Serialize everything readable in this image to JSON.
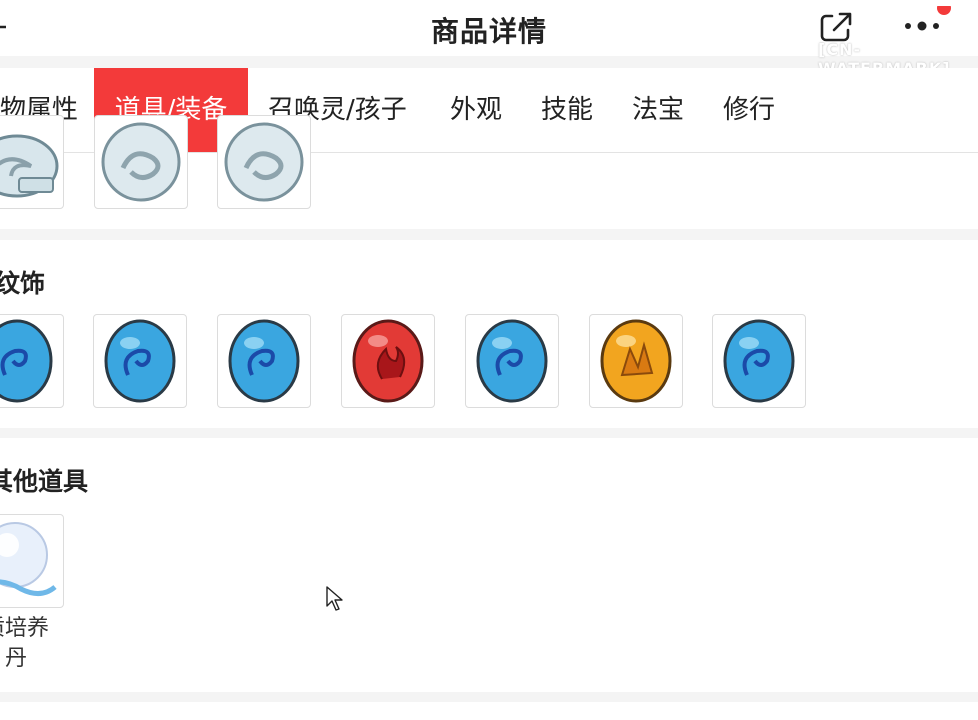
{
  "header": {
    "title": "商品详情",
    "watermark": "[CN-WATERMARK]"
  },
  "tabs": [
    {
      "label": "物属性",
      "active": false
    },
    {
      "label": "道具/装备",
      "active": true
    },
    {
      "label": "召唤灵/孩子",
      "active": false
    },
    {
      "label": "外观",
      "active": false
    },
    {
      "label": "技能",
      "active": false
    },
    {
      "label": "法宝",
      "active": false
    },
    {
      "label": "修行",
      "active": false
    }
  ],
  "sections": [
    {
      "title": "",
      "items": [
        "silver-token",
        "silver-token",
        "silver-token"
      ]
    },
    {
      "title": "纹饰",
      "items": [
        "blue-gem",
        "blue-gem",
        "blue-gem",
        "red-gem",
        "blue-gem",
        "gold-gem",
        "blue-gem"
      ]
    },
    {
      "title": "其他道具",
      "items": [
        {
          "icon": "pearl",
          "label_line1": "质培养",
          "label_line2": "丹"
        }
      ]
    }
  ],
  "colors": {
    "tab_active": "#f33a3a",
    "notification_dot": "#f33a3a"
  }
}
